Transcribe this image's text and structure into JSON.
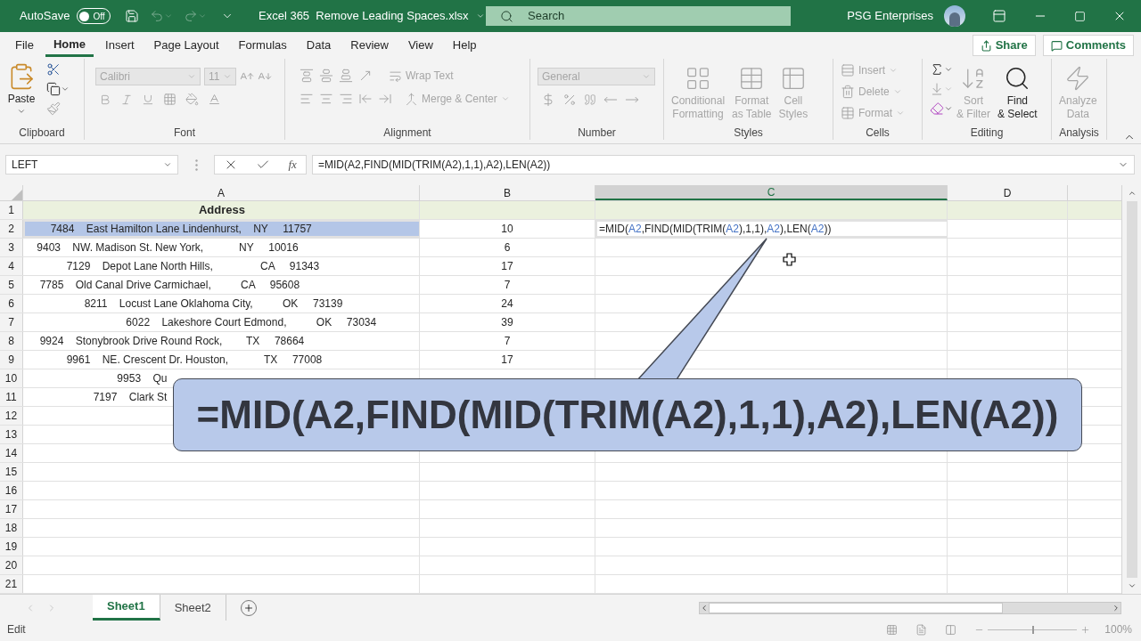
{
  "title_bar": {
    "autosave_label": "AutoSave",
    "autosave_toggle": {
      "label": "Off",
      "on": false
    },
    "file_name": "Excel 365  Remove Leading Spaces.xlsx",
    "search_placeholder": "Search",
    "account_name": "PSG Enterprises"
  },
  "menu_tabs": [
    {
      "label": "File",
      "selected": false
    },
    {
      "label": "Home",
      "selected": true
    },
    {
      "label": "Insert",
      "selected": false
    },
    {
      "label": "Page Layout",
      "selected": false
    },
    {
      "label": "Formulas",
      "selected": false
    },
    {
      "label": "Data",
      "selected": false
    },
    {
      "label": "Review",
      "selected": false
    },
    {
      "label": "View",
      "selected": false
    },
    {
      "label": "Help",
      "selected": false
    }
  ],
  "share_button": "Share",
  "comments_button": "Comments",
  "ribbon": {
    "clipboard": {
      "label": "Clipboard",
      "paste": {
        "label": "Paste",
        "disabled": false
      }
    },
    "font": {
      "label": "Font",
      "font_name": "Calibri",
      "font_size": "11",
      "disabled": true
    },
    "alignment": {
      "label": "Alignment",
      "wrap_text": {
        "label": "Wrap Text",
        "disabled": true
      },
      "merge_center": {
        "label": "Merge & Center",
        "disabled": true
      }
    },
    "number": {
      "label": "Number",
      "format": "General",
      "disabled": true
    },
    "styles": {
      "label": "Styles",
      "buttons": [
        {
          "label": "Conditional Formatting",
          "disabled": true
        },
        {
          "label": "Format as Table",
          "disabled": true
        },
        {
          "label": "Cell Styles",
          "disabled": true
        }
      ]
    },
    "cells": {
      "label": "Cells",
      "buttons": [
        {
          "label": "Insert",
          "disabled": true
        },
        {
          "label": "Delete",
          "disabled": true
        },
        {
          "label": "Format",
          "disabled": true
        }
      ]
    },
    "editing": {
      "label": "Editing",
      "buttons": [
        {
          "label": "Sort & Filter",
          "disabled": true
        },
        {
          "label": "Find & Select",
          "disabled": false
        }
      ]
    },
    "analysis": {
      "label": "Analysis",
      "buttons": [
        {
          "label": "Analyze Data",
          "disabled": true
        }
      ]
    }
  },
  "formula_bar": {
    "name_box": "LEFT",
    "function_label": "fx",
    "formula": "=MID(A2,FIND(MID(TRIM(A2),1,1),A2),LEN(A2))"
  },
  "sheet": {
    "columns": [
      {
        "label": "A",
        "selected": false
      },
      {
        "label": "B",
        "selected": false
      },
      {
        "label": "C",
        "selected": true
      },
      {
        "label": "D",
        "selected": false
      }
    ],
    "rows": [
      {
        "number": "1",
        "kind": "header",
        "a": "Address",
        "a_highlighted": false
      },
      {
        "number": "2",
        "a": "        7484    East Hamilton Lane Lindenhurst,    NY     11757",
        "a_highlighted": true,
        "b": "10",
        "c_active": true,
        "c_tokens": [
          {
            "text": "=MID("
          },
          {
            "text": "A2",
            "color": "#4472c4"
          },
          {
            "text": ",FIND(MID(TRIM("
          },
          {
            "text": "A2",
            "color": "#4472c4"
          },
          {
            "text": "),1,1),"
          },
          {
            "text": "A2",
            "color": "#4472c4"
          },
          {
            "text": "),LEN("
          },
          {
            "text": "A2",
            "color": "#4472c4"
          },
          {
            "text": "))"
          }
        ]
      },
      {
        "number": "3",
        "a": "    9403    NW. Madison St. New York,            NY     10016",
        "a_highlighted": false,
        "b": "6"
      },
      {
        "number": "4",
        "a": "              7129    Depot Lane North Hills,                CA     91343",
        "a_highlighted": false,
        "b": "17"
      },
      {
        "number": "5",
        "a": "     7785    Old Canal Drive Carmichael,          CA     95608",
        "a_highlighted": false,
        "b": "7"
      },
      {
        "number": "6",
        "a": "                    8211    Locust Lane Oklahoma City,          OK     73139",
        "a_highlighted": false,
        "b": "24"
      },
      {
        "number": "7",
        "a": "                                  6022    Lakeshore Court Edmond,          OK     73034",
        "a_highlighted": false,
        "b": "39"
      },
      {
        "number": "8",
        "a": "     9924    Stonybrook Drive Round Rock,        TX     78664",
        "a_highlighted": false,
        "b": "7"
      },
      {
        "number": "9",
        "a": "              9961    NE. Crescent Dr. Houston,            TX     77008",
        "a_highlighted": false,
        "b": "17"
      },
      {
        "number": "10",
        "a": "                               9953    Qu",
        "a_highlighted": false
      },
      {
        "number": "11",
        "a": "                       7197    Clark St",
        "a_highlighted": false
      },
      {
        "number": "12"
      },
      {
        "number": "13"
      },
      {
        "number": "14"
      },
      {
        "number": "15"
      },
      {
        "number": "16"
      },
      {
        "number": "17"
      },
      {
        "number": "18"
      },
      {
        "number": "19"
      },
      {
        "number": "20"
      },
      {
        "number": "21"
      }
    ]
  },
  "callout": {
    "text": "=MID(A2,FIND(MID(TRIM(A2),1,1),A2),LEN(A2))"
  },
  "sheet_tabs": [
    {
      "label": "Sheet1",
      "selected": true
    },
    {
      "label": "Sheet2",
      "selected": false
    }
  ],
  "status_bar": {
    "mode": "Edit",
    "zoom": {
      "reading": "100%",
      "level": 0.5
    }
  }
}
